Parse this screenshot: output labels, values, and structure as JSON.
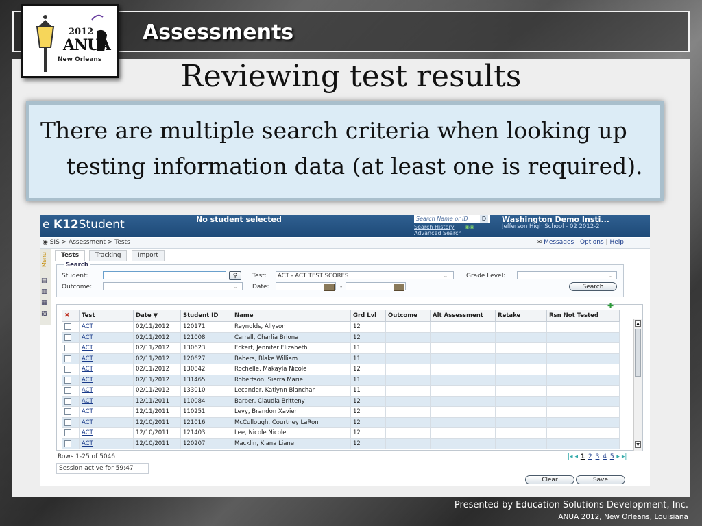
{
  "slide": {
    "header_title": "Assessments",
    "title": "Reviewing test results",
    "callout_line1": "There are multiple search criteria when looking up",
    "callout_line2": "testing information data (at least one is required).",
    "footer_line1": "Presented by Education Solutions Development, Inc.",
    "footer_line2": "ANUA 2012, New Orleans, Louisiana"
  },
  "logo": {
    "year": "2012",
    "name": "ANUA",
    "city": "New Orleans"
  },
  "app": {
    "brand_prefix": "e",
    "brand_bold": "K12",
    "brand_rest": "Student",
    "no_student": "No student selected",
    "search_placeholder": "Search Name or ID",
    "search_go": "D",
    "search_history": "Search History",
    "advanced_search": "Advanced Search",
    "school_name": "Washington Demo Insti...",
    "school_sub": "Jefferson High School - 02 2012-2",
    "breadcrumb": "SIS > Assessment > Tests",
    "links": {
      "messages": "Messages",
      "sep1": " | ",
      "options": "Options",
      "sep2": " | ",
      "help": "Help"
    },
    "menu_label": "Menu",
    "tabs": [
      "Tests",
      "Tracking",
      "Import"
    ]
  },
  "search": {
    "legend": "Search",
    "student_label": "Student:",
    "student_value": "",
    "outcome_label": "Outcome:",
    "test_label": "Test:",
    "test_value": "ACT - ACT TEST SCORES",
    "date_label": "Date:",
    "date_sep": "-",
    "grade_label": "Grade Level:",
    "search_button": "Search"
  },
  "grid": {
    "columns": [
      "Test",
      "Date ▼",
      "Student ID",
      "Name",
      "Grd Lvl",
      "Outcome",
      "Alt Assessment",
      "Retake",
      "Rsn Not Tested"
    ],
    "rows": [
      [
        "ACT",
        "02/11/2012",
        "120171",
        "Reynolds, Allyson",
        "12"
      ],
      [
        "ACT",
        "02/11/2012",
        "121008",
        "Carrell, Charlia Briona",
        "12"
      ],
      [
        "ACT",
        "02/11/2012",
        "130623",
        "Eckert, Jennifer Elizabeth",
        "11"
      ],
      [
        "ACT",
        "02/11/2012",
        "120627",
        "Babers, Blake William",
        "11"
      ],
      [
        "ACT",
        "02/11/2012",
        "130842",
        "Rochelle, Makayla Nicole",
        "12"
      ],
      [
        "ACT",
        "02/11/2012",
        "131465",
        "Robertson, Sierra Marie",
        "11"
      ],
      [
        "ACT",
        "02/11/2012",
        "133010",
        "Lecander, Katlynn Blanchar",
        "11"
      ],
      [
        "ACT",
        "12/11/2011",
        "110084",
        "Barber, Claudia Britteny",
        "12"
      ],
      [
        "ACT",
        "12/11/2011",
        "110251",
        "Levy, Brandon Xavier",
        "12"
      ],
      [
        "ACT",
        "12/10/2011",
        "121016",
        "McCullough, Courtney LaRon",
        "12"
      ],
      [
        "ACT",
        "12/10/2011",
        "121403",
        "Lee, Nicole Nicole",
        "12"
      ],
      [
        "ACT",
        "12/10/2011",
        "120207",
        "Macklin, Kiana Liane",
        "12"
      ]
    ],
    "rows_info": "Rows 1-25 of 5046",
    "pages": [
      "1",
      "2",
      "3",
      "4",
      "5"
    ],
    "session": "Session active for 59:47",
    "clear_button": "Clear",
    "save_button": "Save"
  }
}
